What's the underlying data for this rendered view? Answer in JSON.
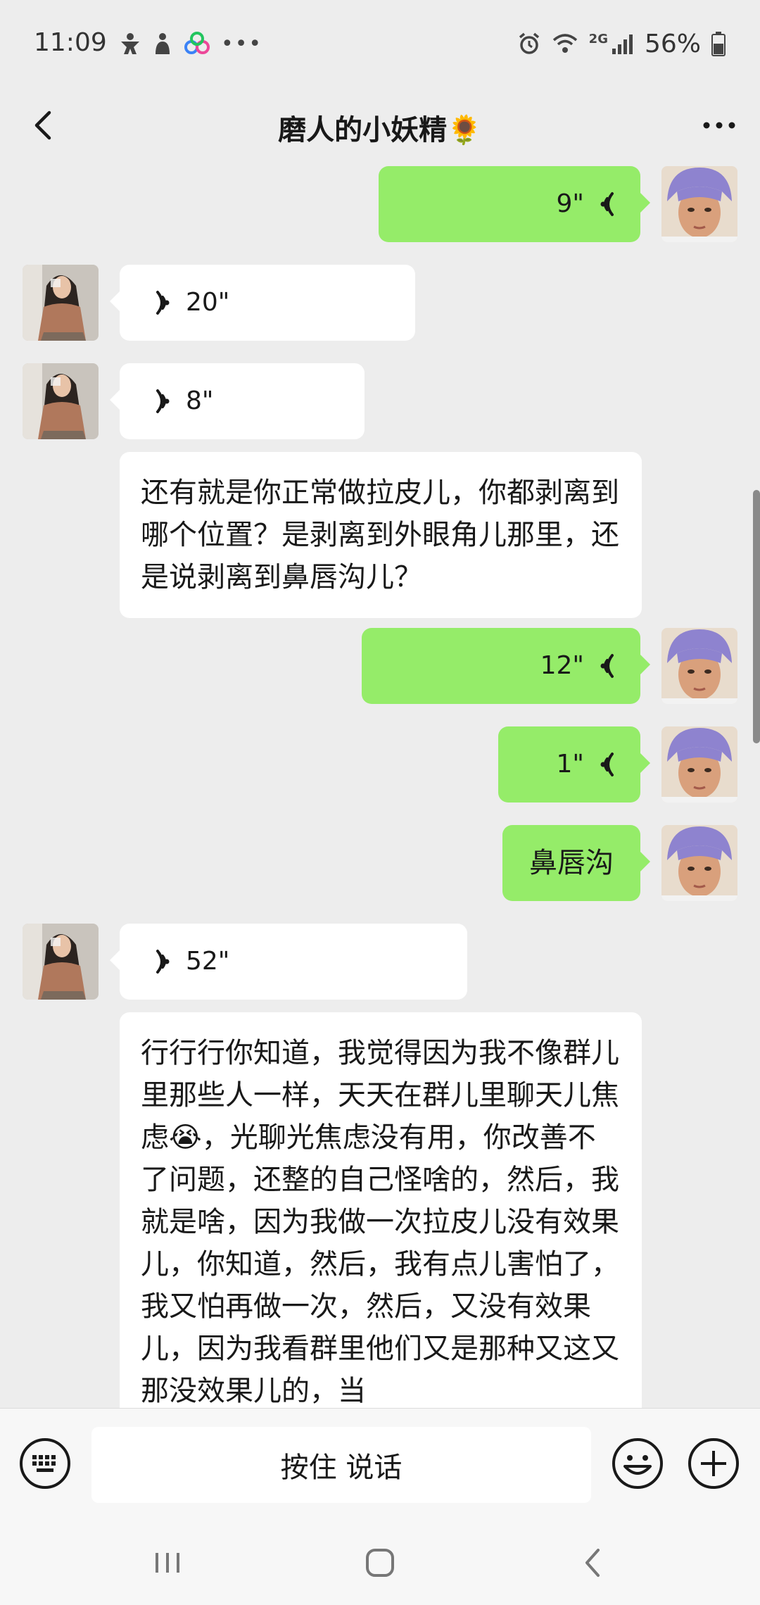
{
  "status_bar": {
    "time": "11:09",
    "network": "2G",
    "battery": "56%"
  },
  "header": {
    "title": "磨人的小妖精🌻"
  },
  "messages": [
    {
      "side": "out",
      "type": "voice",
      "duration": "9\""
    },
    {
      "side": "in",
      "type": "voice",
      "duration": "20\""
    },
    {
      "side": "in",
      "type": "voice",
      "duration": "8\""
    },
    {
      "side": "in",
      "type": "text",
      "text": "还有就是你正常做拉皮儿，你都剥离到哪个位置？是剥离到外眼角儿那里，还是说剥离到鼻唇沟儿？"
    },
    {
      "side": "out",
      "type": "voice",
      "duration": "12\""
    },
    {
      "side": "out",
      "type": "voice",
      "duration": "1\""
    },
    {
      "side": "out",
      "type": "text",
      "text": "鼻唇沟"
    },
    {
      "side": "in",
      "type": "voice",
      "duration": "52\""
    },
    {
      "side": "in",
      "type": "text",
      "text": "行行行你知道，我觉得因为我不像群儿里那些人一样，天天在群儿里聊天儿焦虑😭，光聊光焦虑没有用，你改善不了问题，还整的自己怪啥的，然后，我就是啥，因为我做一次拉皮儿没有效果儿，你知道，然后，我有点儿害怕了，我又怕再做一次，然后，又没有效果儿，因为我看群里他们又是那种又这又那没效果儿的，当"
    }
  ],
  "input_bar": {
    "hold_to_talk": "按住 说话"
  },
  "colors": {
    "background": "#ededed",
    "outgoing_bubble": "#95ec69",
    "incoming_bubble": "#ffffff"
  },
  "icons": [
    "back-arrow-icon",
    "more-icon",
    "voice-wave-icon",
    "keyboard-icon",
    "emoji-icon",
    "plus-icon",
    "recents-icon",
    "home-icon",
    "back-icon"
  ]
}
